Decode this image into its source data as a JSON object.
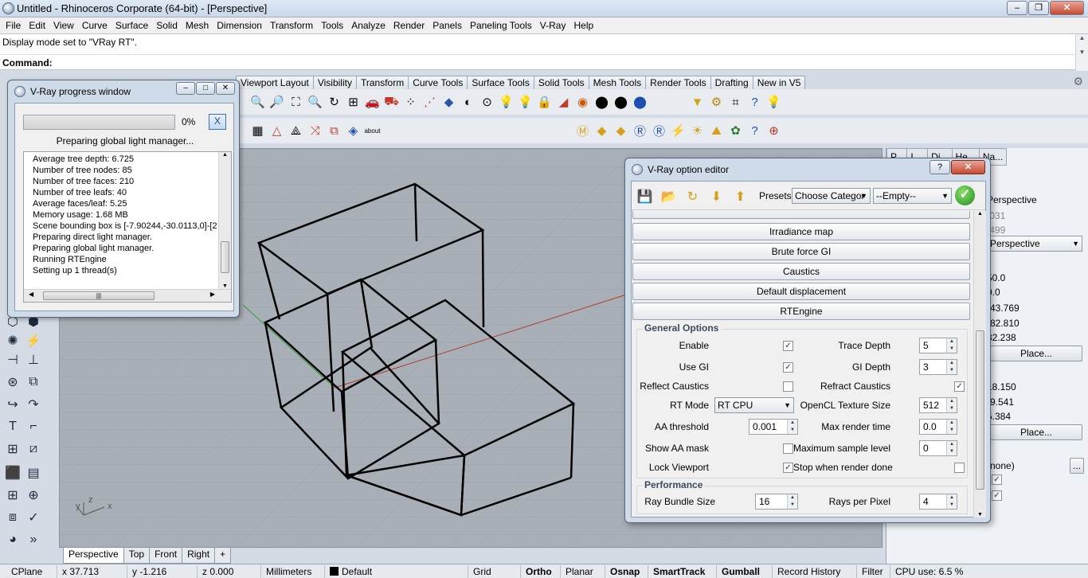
{
  "window": {
    "title": "Untitled - Rhinoceros Corporate (64-bit) - [Perspective]",
    "minimize_icon": "minimize-icon",
    "maximize_icon": "restore-icon",
    "close_icon": "close-icon"
  },
  "menu": [
    "File",
    "Edit",
    "View",
    "Curve",
    "Surface",
    "Solid",
    "Mesh",
    "Dimension",
    "Transform",
    "Tools",
    "Analyze",
    "Render",
    "Panels",
    "Paneling Tools",
    "V-Ray",
    "Help"
  ],
  "command": {
    "history": "Display mode set to \"VRay RT\".",
    "prompt_label": "Command:",
    "input_value": ""
  },
  "toolbar_tabs": [
    "Viewport Layout",
    "Visibility",
    "Transform",
    "Curve Tools",
    "Surface Tools",
    "Solid Tools",
    "Mesh Tools",
    "Render Tools",
    "Drafting",
    "New in V5"
  ],
  "viewport": {
    "name": "Perspective",
    "tabs": [
      "Perspective",
      "Top",
      "Front",
      "Right"
    ],
    "add_tab_icon": "plus-icon"
  },
  "right_panel": {
    "tabs": [
      "P...",
      "L...",
      "Di...",
      "He...",
      "Na..."
    ],
    "perspective_1": "Perspective",
    "val_1031": ".031",
    "val_499": ".499",
    "perspective_2": "Perspective",
    "lens": "50.0",
    "rotation": "0.0",
    "cam_x": "-43.769",
    "cam_y": "-82.810",
    "cam_z": "32.238",
    "place_1": "Place...",
    "tgt_x": "18.150",
    "tgt_y": "-9.541",
    "tgt_z": "5.384",
    "place_2": "Place...",
    "wallpaper": "(none)",
    "browse": "..."
  },
  "status": {
    "cplane": "CPlane",
    "x": "x 37.713",
    "y": "y -1.216",
    "z": "z 0.000",
    "units": "Millimeters",
    "layer": "Default",
    "grid_snap": "Grid Snap",
    "ortho": "Ortho",
    "planar": "Planar",
    "osnap": "Osnap",
    "smarttrack": "SmartTrack",
    "gumball": "Gumball",
    "record_history": "Record History",
    "filter": "Filter",
    "cpu": "CPU use: 6.5 %"
  },
  "progress_window": {
    "title": "V-Ray progress window",
    "percent": "0%",
    "progress": 0.0,
    "cancel_label": "X",
    "status": "Preparing global light manager...",
    "log": [
      "Average tree depth: 6.725",
      "Number of tree nodes: 85",
      "Number of tree faces: 210",
      "Number of tree leafs: 40",
      "Average faces/leaf: 5.25",
      "Memory usage: 1.68 MB",
      "Scene bounding box is [-7.90244,-30.0113,0]-[2",
      "Preparing direct light manager.",
      "Preparing global light manager.",
      "Running RTEngine",
      "Setting up 1 thread(s)"
    ]
  },
  "option_editor": {
    "title": "V-Ray option editor",
    "help_label": "?",
    "presets_label": "Presets:",
    "category_combo": "Choose Categor",
    "preset_combo": "--Empty--",
    "rollouts": [
      "Irradiance map",
      "Brute force GI",
      "Caustics",
      "Default displacement",
      "RTEngine"
    ],
    "general_options": {
      "title": "General Options",
      "enable_label": "Enable",
      "enable_checked": true,
      "trace_depth_label": "Trace Depth",
      "trace_depth": "5",
      "use_gi_label": "Use GI",
      "use_gi_checked": true,
      "gi_depth_label": "GI Depth",
      "gi_depth": "3",
      "reflect_caustics_label": "Reflect Caustics",
      "reflect_caustics_checked": false,
      "refract_caustics_label": "Refract Caustics",
      "refract_caustics_checked": true,
      "rt_mode_label": "RT Mode",
      "rt_mode": "RT CPU",
      "opencl_label": "OpenCL Texture Size",
      "opencl": "512",
      "aa_threshold_label": "AA threshold",
      "aa_threshold": "0.001",
      "max_render_time_label": "Max render time",
      "max_render_time": "0.0",
      "show_aa_mask_label": "Show AA mask",
      "show_aa_mask_checked": false,
      "max_sample_level_label": "Maximum sample level",
      "max_sample_level": "0",
      "lock_viewport_label": "Lock Viewport",
      "lock_viewport_checked": true,
      "stop_when_done_label": "Stop when render done",
      "stop_when_done_checked": false
    },
    "performance": {
      "title": "Performance",
      "ray_bundle_label": "Ray Bundle Size",
      "ray_bundle": "16",
      "rays_per_pixel_label": "Rays per Pixel",
      "rays_per_pixel": "4"
    }
  },
  "axis_labels": {
    "y": "y",
    "z": "z",
    "x": "x"
  },
  "colors": {
    "viewport_bg": "#a9afb6",
    "x_axis": "#c0392b",
    "y_axis": "#2e9e3a",
    "accent": "#3f6ea8"
  }
}
